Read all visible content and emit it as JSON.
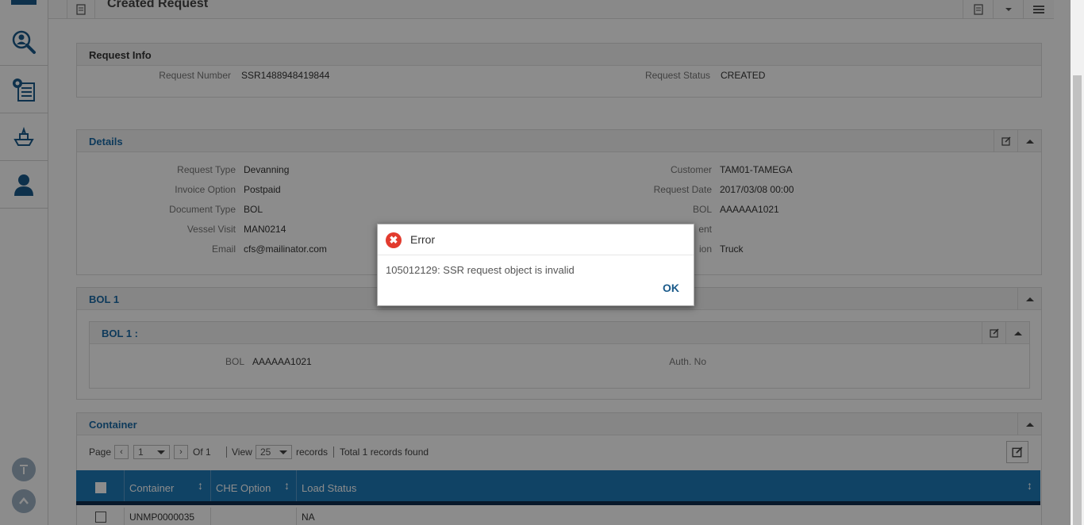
{
  "header": {
    "title": "Created Request"
  },
  "request_info": {
    "title": "Request Info",
    "request_number_label": "Request Number",
    "request_number": "SSR1488948419844",
    "request_status_label": "Request Status",
    "request_status": "CREATED"
  },
  "details": {
    "title": "Details",
    "left": [
      {
        "label": "Request Type",
        "value": "Devanning"
      },
      {
        "label": "Invoice Option",
        "value": "Postpaid"
      },
      {
        "label": "Document Type",
        "value": "BOL"
      },
      {
        "label": "Vessel Visit",
        "value": "MAN0214"
      },
      {
        "label": "Email",
        "value": "cfs@mailinator.com"
      }
    ],
    "right": [
      {
        "label": "Customer",
        "value": "TAM01-TAMEGA"
      },
      {
        "label": "Request Date",
        "value": "2017/03/08 00:00"
      },
      {
        "label": "BOL",
        "value": "AAAAAA1021"
      },
      {
        "label": "ent",
        "value": ""
      },
      {
        "label": "ion",
        "value": "Truck"
      }
    ]
  },
  "bol": {
    "title": "BOL 1",
    "sub_title": "BOL 1 :",
    "bol_label": "BOL",
    "bol_value": "AAAAAA1021",
    "auth_label": "Auth. No"
  },
  "container": {
    "title": "Container",
    "page_label": "Page",
    "page_value": "1",
    "of_label": "Of 1",
    "view_label": "View",
    "view_value": "25",
    "records_label": "records",
    "total_label": "Total 1 records found",
    "columns": [
      "Container",
      "CHE Option",
      "Load Status"
    ],
    "rows": [
      {
        "container": "UNMP0000035",
        "che_option": "",
        "load_status": "NA"
      }
    ]
  },
  "dialog": {
    "title": "Error",
    "message": "105012129: SSR request object is invalid",
    "ok_label": "OK"
  },
  "colors": {
    "accent": "#1a6aa6",
    "table_header": "#1e7ab8",
    "error": "#e23b2e"
  }
}
